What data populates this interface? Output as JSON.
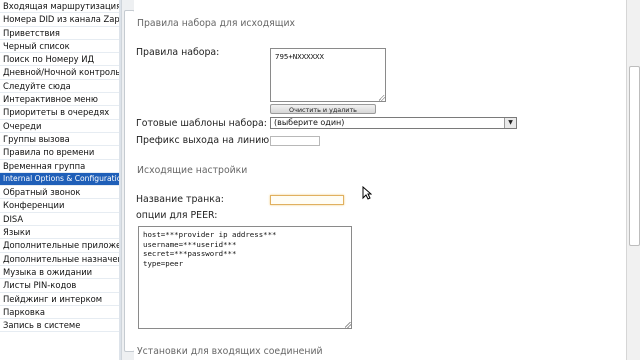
{
  "sidebar": {
    "items": [
      {
        "label": "Входящая маршрутизация"
      },
      {
        "label": "Номера DID из канала Zap"
      },
      {
        "label": "Приветствия"
      },
      {
        "label": "Черный список"
      },
      {
        "label": "Поиск по Номеру ИД"
      },
      {
        "label": "Дневной/Ночной контроль"
      },
      {
        "label": "Следуйте сюда"
      },
      {
        "label": "Интерактивное меню"
      },
      {
        "label": "Приоритеты в очередях"
      },
      {
        "label": "Очереди"
      },
      {
        "label": "Группы вызова"
      },
      {
        "label": "Правила по времени"
      },
      {
        "label": "Временная группа"
      },
      {
        "label": "Internal Options & Configuration",
        "active": true
      },
      {
        "label": "Обратный звонок"
      },
      {
        "label": "Конференции"
      },
      {
        "label": "DISA"
      },
      {
        "label": "Языки"
      },
      {
        "label": "Дополнительные приложения"
      },
      {
        "label": "Дополнительные назначения"
      },
      {
        "label": "Музыка в ожидании"
      },
      {
        "label": "Листы PIN-кодов"
      },
      {
        "label": "Пейджинг и интерком"
      },
      {
        "label": "Парковка"
      },
      {
        "label": "Запись в системе"
      }
    ]
  },
  "main": {
    "outgoing_rules_title": "Правила набора для исходящих",
    "dial_rules_label": "Правила набора:",
    "dial_rules_value": "795+NXXXXXX",
    "clean_button_label": "Очистить и удалить дубликаты",
    "templates_label": "Готовые шаблоны набора:",
    "templates_selected": "(выберите один)",
    "prefix_label": "Префикс выхода на линию:",
    "outgoing_settings_title": "Исходящие настройки",
    "trunk_name_label": "Название транка:",
    "peer_options_label": "опции для PEER:",
    "peer_options_value": "host=***provider ip address***\nusername=***userid***\nsecret=***password***\ntype=peer",
    "incoming_settings_title": "Установки для входящих соединений"
  },
  "colors": {
    "active_item_bg": "#1f5fb8",
    "focus_border": "#e0b060",
    "deco": "#f3dfa8"
  }
}
